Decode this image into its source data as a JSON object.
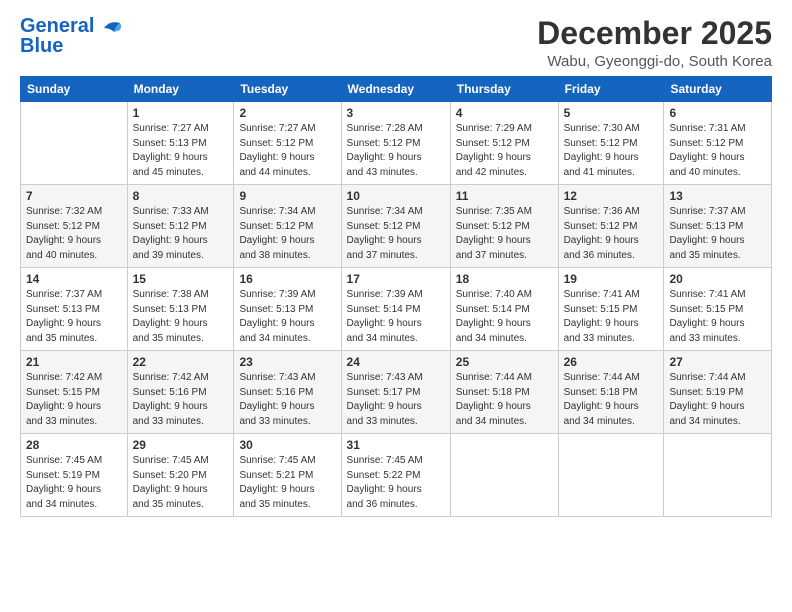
{
  "header": {
    "logo_line1": "General",
    "logo_line2": "Blue",
    "month_title": "December 2025",
    "location": "Wabu, Gyeonggi-do, South Korea"
  },
  "weekdays": [
    "Sunday",
    "Monday",
    "Tuesday",
    "Wednesday",
    "Thursday",
    "Friday",
    "Saturday"
  ],
  "weeks": [
    [
      {
        "day": "",
        "info": ""
      },
      {
        "day": "1",
        "info": "Sunrise: 7:27 AM\nSunset: 5:13 PM\nDaylight: 9 hours\nand 45 minutes."
      },
      {
        "day": "2",
        "info": "Sunrise: 7:27 AM\nSunset: 5:12 PM\nDaylight: 9 hours\nand 44 minutes."
      },
      {
        "day": "3",
        "info": "Sunrise: 7:28 AM\nSunset: 5:12 PM\nDaylight: 9 hours\nand 43 minutes."
      },
      {
        "day": "4",
        "info": "Sunrise: 7:29 AM\nSunset: 5:12 PM\nDaylight: 9 hours\nand 42 minutes."
      },
      {
        "day": "5",
        "info": "Sunrise: 7:30 AM\nSunset: 5:12 PM\nDaylight: 9 hours\nand 41 minutes."
      },
      {
        "day": "6",
        "info": "Sunrise: 7:31 AM\nSunset: 5:12 PM\nDaylight: 9 hours\nand 40 minutes."
      }
    ],
    [
      {
        "day": "7",
        "info": "Sunrise: 7:32 AM\nSunset: 5:12 PM\nDaylight: 9 hours\nand 40 minutes."
      },
      {
        "day": "8",
        "info": "Sunrise: 7:33 AM\nSunset: 5:12 PM\nDaylight: 9 hours\nand 39 minutes."
      },
      {
        "day": "9",
        "info": "Sunrise: 7:34 AM\nSunset: 5:12 PM\nDaylight: 9 hours\nand 38 minutes."
      },
      {
        "day": "10",
        "info": "Sunrise: 7:34 AM\nSunset: 5:12 PM\nDaylight: 9 hours\nand 37 minutes."
      },
      {
        "day": "11",
        "info": "Sunrise: 7:35 AM\nSunset: 5:12 PM\nDaylight: 9 hours\nand 37 minutes."
      },
      {
        "day": "12",
        "info": "Sunrise: 7:36 AM\nSunset: 5:12 PM\nDaylight: 9 hours\nand 36 minutes."
      },
      {
        "day": "13",
        "info": "Sunrise: 7:37 AM\nSunset: 5:13 PM\nDaylight: 9 hours\nand 35 minutes."
      }
    ],
    [
      {
        "day": "14",
        "info": "Sunrise: 7:37 AM\nSunset: 5:13 PM\nDaylight: 9 hours\nand 35 minutes."
      },
      {
        "day": "15",
        "info": "Sunrise: 7:38 AM\nSunset: 5:13 PM\nDaylight: 9 hours\nand 35 minutes."
      },
      {
        "day": "16",
        "info": "Sunrise: 7:39 AM\nSunset: 5:13 PM\nDaylight: 9 hours\nand 34 minutes."
      },
      {
        "day": "17",
        "info": "Sunrise: 7:39 AM\nSunset: 5:14 PM\nDaylight: 9 hours\nand 34 minutes."
      },
      {
        "day": "18",
        "info": "Sunrise: 7:40 AM\nSunset: 5:14 PM\nDaylight: 9 hours\nand 34 minutes."
      },
      {
        "day": "19",
        "info": "Sunrise: 7:41 AM\nSunset: 5:15 PM\nDaylight: 9 hours\nand 33 minutes."
      },
      {
        "day": "20",
        "info": "Sunrise: 7:41 AM\nSunset: 5:15 PM\nDaylight: 9 hours\nand 33 minutes."
      }
    ],
    [
      {
        "day": "21",
        "info": "Sunrise: 7:42 AM\nSunset: 5:15 PM\nDaylight: 9 hours\nand 33 minutes."
      },
      {
        "day": "22",
        "info": "Sunrise: 7:42 AM\nSunset: 5:16 PM\nDaylight: 9 hours\nand 33 minutes."
      },
      {
        "day": "23",
        "info": "Sunrise: 7:43 AM\nSunset: 5:16 PM\nDaylight: 9 hours\nand 33 minutes."
      },
      {
        "day": "24",
        "info": "Sunrise: 7:43 AM\nSunset: 5:17 PM\nDaylight: 9 hours\nand 33 minutes."
      },
      {
        "day": "25",
        "info": "Sunrise: 7:44 AM\nSunset: 5:18 PM\nDaylight: 9 hours\nand 34 minutes."
      },
      {
        "day": "26",
        "info": "Sunrise: 7:44 AM\nSunset: 5:18 PM\nDaylight: 9 hours\nand 34 minutes."
      },
      {
        "day": "27",
        "info": "Sunrise: 7:44 AM\nSunset: 5:19 PM\nDaylight: 9 hours\nand 34 minutes."
      }
    ],
    [
      {
        "day": "28",
        "info": "Sunrise: 7:45 AM\nSunset: 5:19 PM\nDaylight: 9 hours\nand 34 minutes."
      },
      {
        "day": "29",
        "info": "Sunrise: 7:45 AM\nSunset: 5:20 PM\nDaylight: 9 hours\nand 35 minutes."
      },
      {
        "day": "30",
        "info": "Sunrise: 7:45 AM\nSunset: 5:21 PM\nDaylight: 9 hours\nand 35 minutes."
      },
      {
        "day": "31",
        "info": "Sunrise: 7:45 AM\nSunset: 5:22 PM\nDaylight: 9 hours\nand 36 minutes."
      },
      {
        "day": "",
        "info": ""
      },
      {
        "day": "",
        "info": ""
      },
      {
        "day": "",
        "info": ""
      }
    ]
  ]
}
